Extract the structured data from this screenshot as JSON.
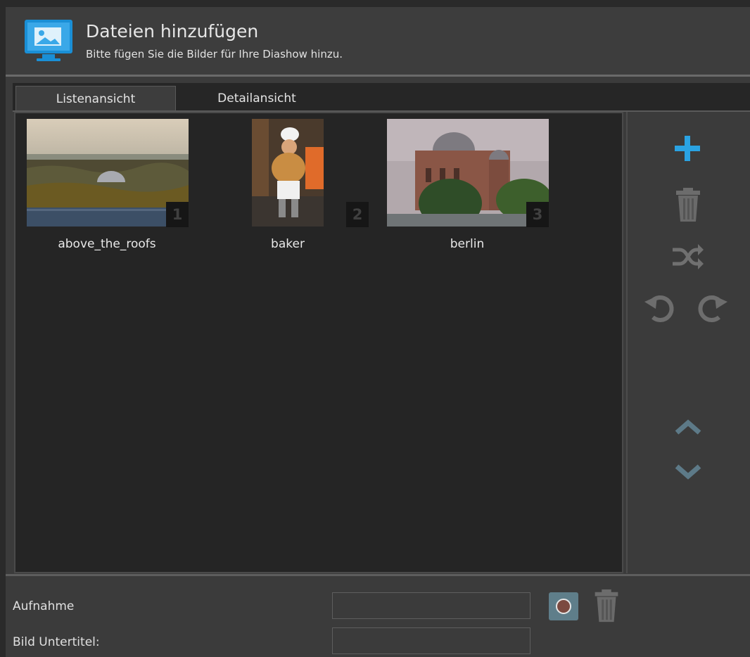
{
  "header": {
    "title": "Dateien hinzufügen",
    "subtitle": "Bitte fügen Sie die Bilder für Ihre Diashow hinzu."
  },
  "tabs": [
    {
      "label": "Listenansicht",
      "active": true
    },
    {
      "label": "Detailansicht",
      "active": false
    }
  ],
  "images": [
    {
      "number": "1",
      "name": "above_the_roofs"
    },
    {
      "number": "2",
      "name": "baker"
    },
    {
      "number": "3",
      "name": "berlin"
    }
  ],
  "sidebar": {
    "icons": [
      "add-icon",
      "trash-icon",
      "shuffle-icon",
      "rotate-left-icon",
      "rotate-right-icon",
      "move-up-icon",
      "move-down-icon"
    ],
    "accent_color": "#2aa3e3"
  },
  "form": {
    "recording_label": "Aufnahme",
    "recording_value": "",
    "caption_label": "Bild Untertitel:",
    "caption_value": ""
  }
}
